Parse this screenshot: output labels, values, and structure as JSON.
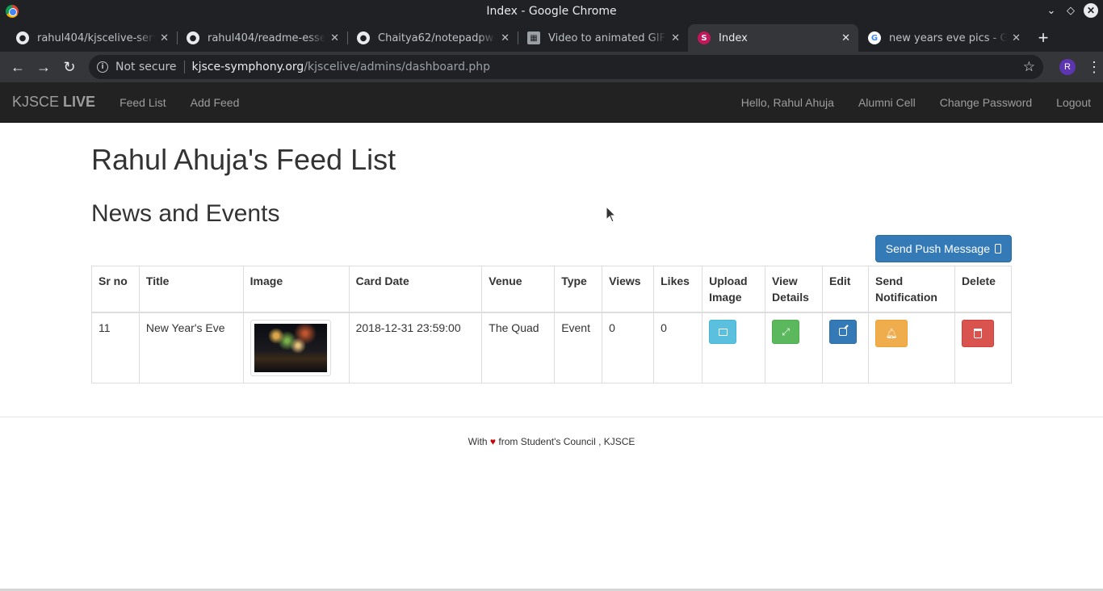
{
  "window": {
    "title": "Index - Google Chrome"
  },
  "tabs": [
    {
      "label": "rahul404/kjscelive-server",
      "favicon": "github-icon",
      "active": false
    },
    {
      "label": "rahul404/readme-essentials",
      "favicon": "github-icon",
      "active": false
    },
    {
      "label": "Chaitya62/notepadpw-clone",
      "favicon": "github-icon",
      "active": false
    },
    {
      "label": "Video to animated GIF converter",
      "favicon": "video-icon",
      "active": false
    },
    {
      "label": "Index",
      "favicon": "s-logo-icon",
      "active": true
    },
    {
      "label": "new years eve pics - Google Search",
      "favicon": "google-icon",
      "active": false
    }
  ],
  "address": {
    "security": "Not secure",
    "host": "kjsce-symphony.org",
    "path": "/kjscelive/admins/dashboard.php",
    "avatar_letter": "R"
  },
  "navbar": {
    "brand_prefix": "KJSCE",
    "brand_bold": "LIVE",
    "left_links": [
      "Feed List",
      "Add Feed"
    ],
    "right_links": [
      "Hello, Rahul Ahuja",
      "Alumni Cell",
      "Change Password",
      "Logout"
    ]
  },
  "page": {
    "title": "Rahul Ahuja's Feed List",
    "section": "News and Events",
    "push_button": "Send Push Message"
  },
  "table": {
    "headers": [
      "Sr no",
      "Title",
      "Image",
      "Card Date",
      "Venue",
      "Type",
      "Views",
      "Likes",
      "Upload Image",
      "View Details",
      "Edit",
      "Send Notification",
      "Delete"
    ],
    "rows": [
      {
        "sr": "11",
        "title": "New Year's Eve",
        "card_date": "2018-12-31 23:59:00",
        "venue": "The Quad",
        "type": "Event",
        "views": "0",
        "likes": "0"
      }
    ]
  },
  "footer": {
    "prefix": "With",
    "heart": "♥",
    "suffix": "from Student's Council , KJSCE"
  },
  "colors": {
    "primary": "#337ab7",
    "info": "#5bc0de",
    "success": "#5cb85c",
    "warning": "#f0ad4e",
    "danger": "#d9534f",
    "navbar": "#222222"
  }
}
